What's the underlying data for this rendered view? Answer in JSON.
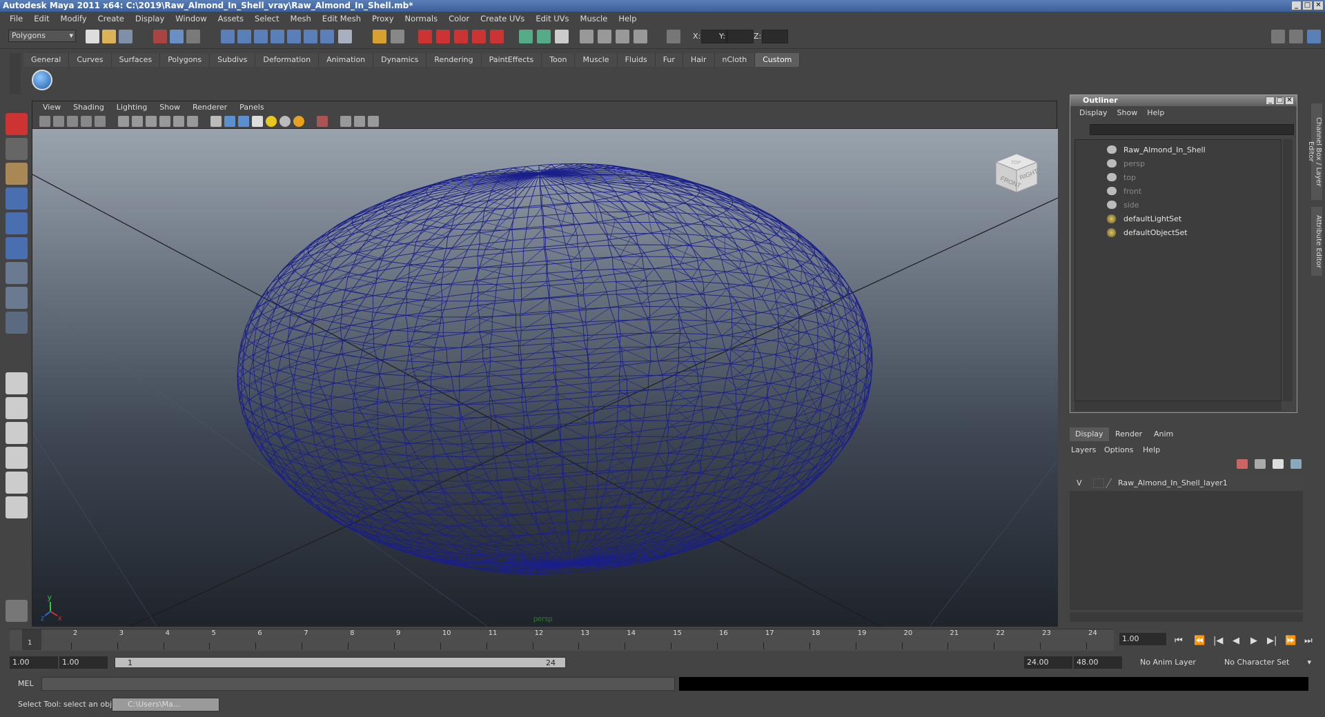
{
  "titlebar": {
    "title": "Autodesk Maya 2011 x64: C:\\2019\\Raw_Almond_In_Shell_vray\\Raw_Almond_In_Shell.mb*"
  },
  "menubar": [
    "File",
    "Edit",
    "Modify",
    "Create",
    "Display",
    "Window",
    "Assets",
    "Select",
    "Mesh",
    "Edit Mesh",
    "Proxy",
    "Normals",
    "Color",
    "Create UVs",
    "Edit UVs",
    "Muscle",
    "Help"
  ],
  "statusline": {
    "mode": "Polygons",
    "x_label": "X:",
    "y_label": "Y:",
    "z_label": "Z:"
  },
  "shelf": {
    "tabs": [
      "General",
      "Curves",
      "Surfaces",
      "Polygons",
      "Subdivs",
      "Deformation",
      "Animation",
      "Dynamics",
      "Rendering",
      "PaintEffects",
      "Toon",
      "Muscle",
      "Fluids",
      "Fur",
      "Hair",
      "nCloth",
      "Custom"
    ],
    "active_tab": "Custom"
  },
  "viewport": {
    "menu": [
      "View",
      "Shading",
      "Lighting",
      "Show",
      "Renderer",
      "Panels"
    ],
    "camera_label": "persp",
    "viewcube": {
      "front": "FRONT",
      "right": "RIGHT",
      "top": "TOP"
    },
    "axis": {
      "x": "x",
      "y": "y",
      "z": "z"
    },
    "wire_color": "#1a1f8a"
  },
  "outliner": {
    "title": "Outliner",
    "menu": [
      "Display",
      "Show",
      "Help"
    ],
    "items": [
      {
        "label": "Raw_Almond_In_Shell",
        "dim": false,
        "icon": "mesh-icon"
      },
      {
        "label": "persp",
        "dim": true,
        "icon": "camera-icon"
      },
      {
        "label": "top",
        "dim": true,
        "icon": "camera-icon"
      },
      {
        "label": "front",
        "dim": true,
        "icon": "camera-icon"
      },
      {
        "label": "side",
        "dim": true,
        "icon": "camera-icon"
      },
      {
        "label": "defaultLightSet",
        "dim": false,
        "icon": "set-icon"
      },
      {
        "label": "defaultObjectSet",
        "dim": false,
        "icon": "set-icon"
      }
    ]
  },
  "layers": {
    "tabs": [
      "Display",
      "Render",
      "Anim"
    ],
    "menu": [
      "Layers",
      "Options",
      "Help"
    ],
    "row": {
      "visibility": "V",
      "name": "Raw_Almond_In_Shell_layer1"
    }
  },
  "sidetabs": [
    "Channel Box / Layer Editor",
    "Attribute Editor"
  ],
  "timeline": {
    "ticks": [
      "1",
      "2",
      "3",
      "4",
      "5",
      "6",
      "7",
      "8",
      "9",
      "10",
      "11",
      "12",
      "13",
      "14",
      "15",
      "16",
      "17",
      "18",
      "19",
      "20",
      "21",
      "22",
      "23",
      "24"
    ],
    "current_frame_marker": "1",
    "current_frame": "1.00"
  },
  "range": {
    "start": "1.00",
    "inner_start": "1.00",
    "slider_start": "1",
    "slider_end": "24",
    "end": "24.00",
    "outer_end": "48.00",
    "anim_layer": "No Anim Layer",
    "character_set": "No Character Set"
  },
  "mel": {
    "label": "MEL"
  },
  "helpline": {
    "text": "Select Tool: select an object",
    "task": "C:\\Users\\Ma..."
  }
}
